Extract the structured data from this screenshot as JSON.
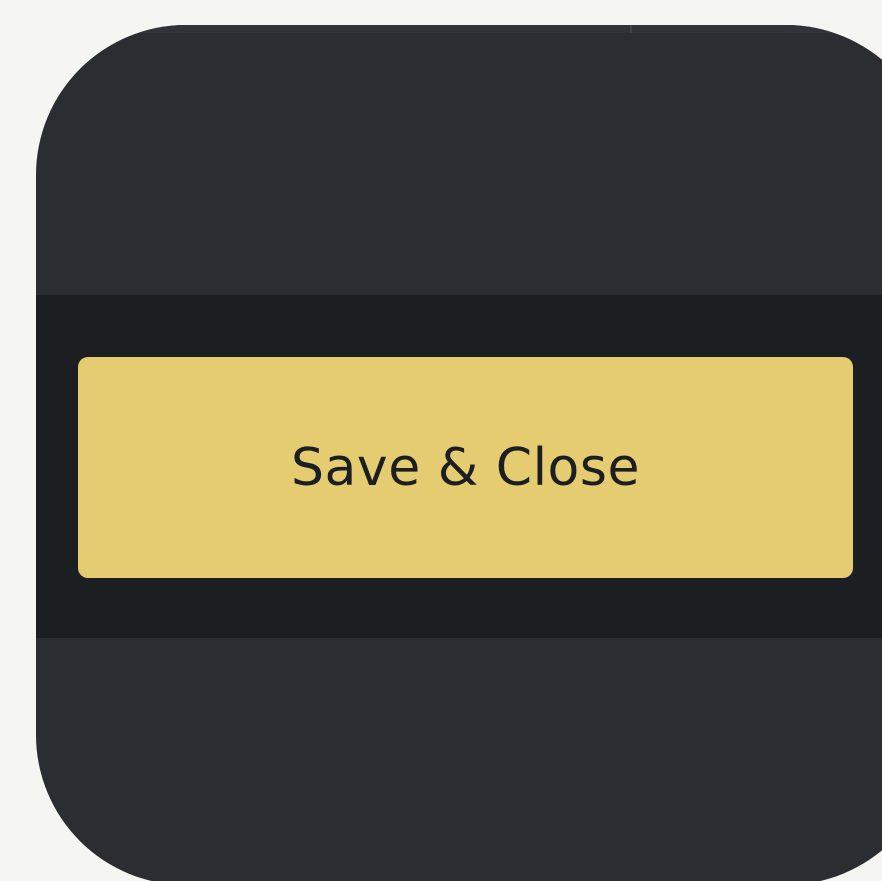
{
  "footer": {
    "primary_button": {
      "label": "Save & Close"
    }
  },
  "colors": {
    "page_background": "#f5f5f1",
    "panel_background": "#2a2e32",
    "footer_background": "#1b1f22",
    "button_fill": "#e5cc71",
    "button_text": "#1b1f22"
  }
}
